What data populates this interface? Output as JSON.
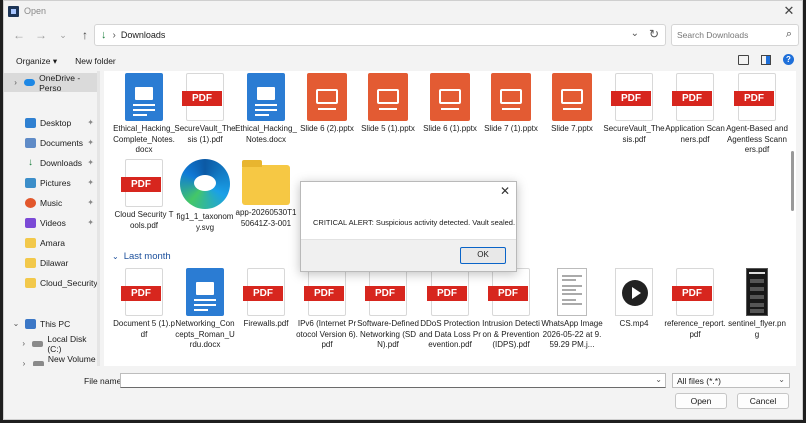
{
  "window": {
    "title": "Open"
  },
  "nav": {
    "path": "Downloads",
    "search_placeholder": "Search Downloads"
  },
  "commands": {
    "organize": "Organize ▾",
    "new_folder": "New folder"
  },
  "sidebar": {
    "items": [
      {
        "label": "OneDrive - Perso",
        "icon": "cloud-icon"
      },
      {
        "label": "Desktop",
        "icon": "desktop-icon"
      },
      {
        "label": "Documents",
        "icon": "documents-icon"
      },
      {
        "label": "Downloads",
        "icon": "downloads-icon"
      },
      {
        "label": "Pictures",
        "icon": "pictures-icon"
      },
      {
        "label": "Music",
        "icon": "music-icon"
      },
      {
        "label": "Videos",
        "icon": "videos-icon"
      },
      {
        "label": "Amara",
        "icon": "folder-icon"
      },
      {
        "label": "Dilawar",
        "icon": "folder-icon"
      },
      {
        "label": "Cloud_Security",
        "icon": "folder-icon"
      },
      {
        "label": "This PC",
        "icon": "pc-icon"
      },
      {
        "label": "Local Disk (C:)",
        "icon": "disk-icon"
      },
      {
        "label": "New Volume (",
        "icon": "disk-icon"
      }
    ]
  },
  "files_top": [
    {
      "name": "Ethical_Hacking_Complete_Notes.docx",
      "type": "docx"
    },
    {
      "name": "SecureVault_Thesis (1).pdf",
      "type": "pdf"
    },
    {
      "name": "Ethical_Hacking_Notes.docx",
      "type": "docx"
    },
    {
      "name": "Slide 6 (2).pptx",
      "type": "pptx"
    },
    {
      "name": "Slide 5 (1).pptx",
      "type": "pptx"
    },
    {
      "name": "Slide 6 (1).pptx",
      "type": "pptx"
    },
    {
      "name": "Slide 7 (1).pptx",
      "type": "pptx"
    },
    {
      "name": "Slide 7.pptx",
      "type": "pptx"
    },
    {
      "name": "SecureVault_Thesis.pdf",
      "type": "pdf"
    },
    {
      "name": "Application Scanners.pdf",
      "type": "pdf"
    },
    {
      "name": "Agent-Based and Agentless Scanners.pdf",
      "type": "pdf"
    },
    {
      "name": "Cloud Security Tools.pdf",
      "type": "pdf"
    },
    {
      "name": "fig1_1_taxonomy.svg",
      "type": "edge"
    },
    {
      "name": "app-20260530T150641Z-3-001",
      "type": "folder"
    }
  ],
  "group_header": "Last month",
  "files_month": [
    {
      "name": "Document 5 (1).pdf",
      "type": "pdf"
    },
    {
      "name": "Networking_Concepts_Roman_Urdu.docx",
      "type": "docx"
    },
    {
      "name": "Firewalls.pdf",
      "type": "pdf"
    },
    {
      "name": "IPv6 (Internet Protocol Version 6).pdf",
      "type": "pdf"
    },
    {
      "name": "Software-Defined Networking (SDN).pdf",
      "type": "pdf"
    },
    {
      "name": "DDoS Protection and Data Loss Prevention.pdf",
      "type": "pdf"
    },
    {
      "name": "Intrusion Detection & Prevention (IDPS).pdf",
      "type": "pdf"
    },
    {
      "name": "WhatsApp Image 2026-05-22 at 9.59.29 PM.j...",
      "type": "image"
    },
    {
      "name": "CS.mp4",
      "type": "mp4"
    },
    {
      "name": "reference_report.pdf",
      "type": "pdf"
    },
    {
      "name": "sentinel_flyer.png",
      "type": "flyer"
    }
  ],
  "pdf_badge": "PDF",
  "flyer_title": "SENTINEL",
  "bottom": {
    "file_name_label": "File name:",
    "file_name_value": "",
    "filter": "All files (*.*)",
    "open": "Open",
    "cancel": "Cancel"
  },
  "dialog": {
    "message": "CRITICAL ALERT: Suspicious activity detected. Vault sealed.",
    "ok": "OK"
  }
}
